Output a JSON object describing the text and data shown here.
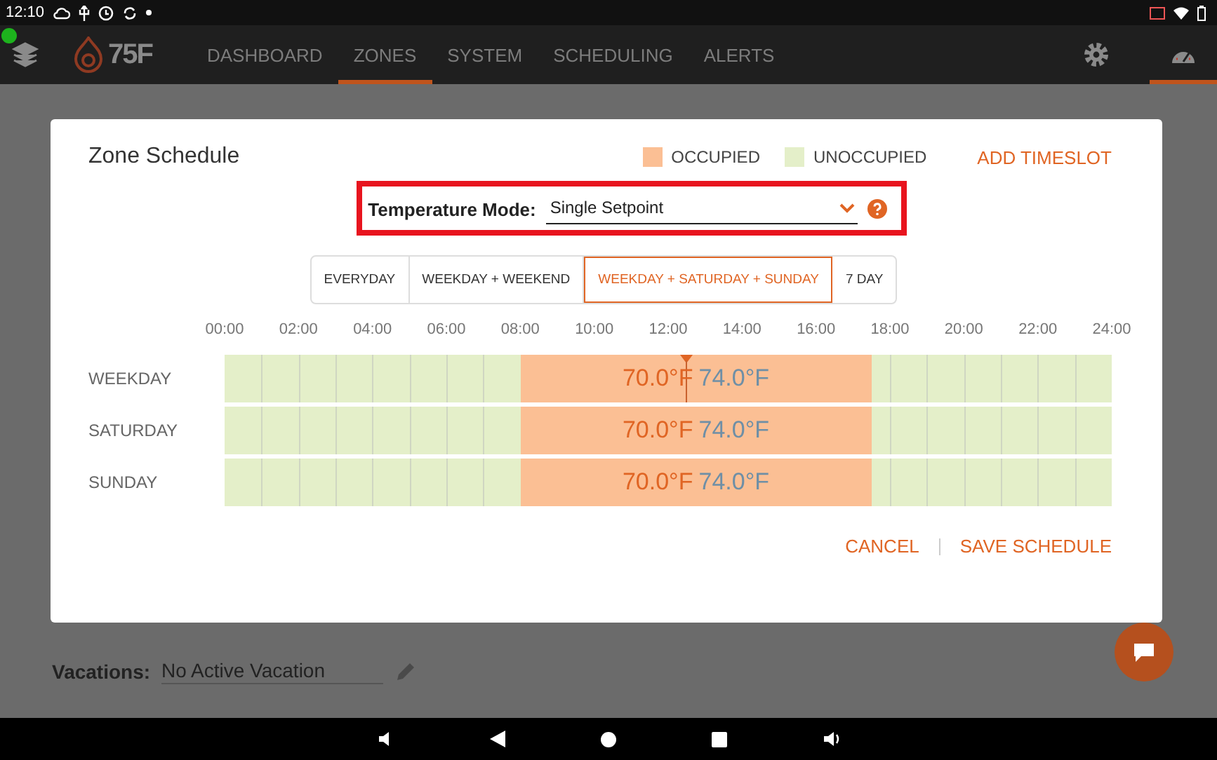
{
  "status_bar": {
    "time": "12:10"
  },
  "nav": {
    "logo": "75F",
    "tabs": [
      {
        "label": "DASHBOARD",
        "selected": false
      },
      {
        "label": "ZONES",
        "selected": true
      },
      {
        "label": "SYSTEM",
        "selected": false
      },
      {
        "label": "SCHEDULING",
        "selected": false
      },
      {
        "label": "ALERTS",
        "selected": false
      }
    ],
    "gauge_selected": true
  },
  "dialog": {
    "title": "Zone Schedule",
    "legend": [
      {
        "label": "OCCUPIED",
        "color": "#fbbf94"
      },
      {
        "label": "UNOCCUPIED",
        "color": "#e4efc9"
      }
    ],
    "add_button": "ADD TIMESLOT",
    "temperature_mode": {
      "label": "Temperature Mode:",
      "value": "Single Setpoint"
    },
    "schedule_types": [
      {
        "label": "EVERYDAY",
        "selected": false
      },
      {
        "label": "WEEKDAY + WEEKEND",
        "selected": false
      },
      {
        "label": "WEEKDAY + SATURDAY + SUNDAY",
        "selected": true
      },
      {
        "label": "7 DAY",
        "selected": false
      }
    ],
    "hours": [
      "00:00",
      "02:00",
      "04:00",
      "06:00",
      "08:00",
      "10:00",
      "12:00",
      "14:00",
      "16:00",
      "18:00",
      "20:00",
      "22:00",
      "24:00"
    ],
    "rows": [
      {
        "day": "WEEKDAY",
        "heat": "70.0°F",
        "cool": "74.0°F",
        "now_marker": true
      },
      {
        "day": "SATURDAY",
        "heat": "70.0°F",
        "cool": "74.0°F",
        "now_marker": false
      },
      {
        "day": "SUNDAY",
        "heat": "70.0°F",
        "cool": "74.0°F",
        "now_marker": false
      }
    ],
    "buttons": [
      "CANCEL",
      "SAVE SCHEDULE"
    ]
  },
  "background": {
    "vacations_label": "Vacations:",
    "vacations_value": "No Active Vacation"
  }
}
